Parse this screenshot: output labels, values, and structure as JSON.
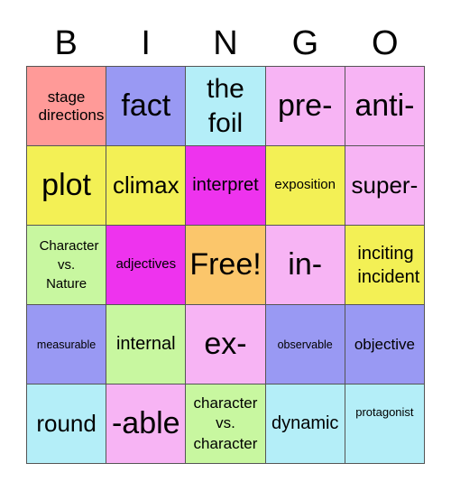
{
  "title_letters": [
    "B",
    "I",
    "N",
    "G",
    "O"
  ],
  "colors": {
    "salmon": "#FF9A98",
    "periwinkle": "#9999F3",
    "cyan": "#B4EEF8",
    "pink": "#F7B4F4",
    "yellow": "#F3F055",
    "magenta": "#EE33EE",
    "green": "#C8F7A0",
    "orange": "#FBC66B",
    "border": "#555555"
  },
  "board": {
    "rows": [
      [
        {
          "text": "stage directions",
          "color": "salmon"
        },
        {
          "text": "fact",
          "color": "periwinkle"
        },
        {
          "text": "the foil",
          "color": "cyan"
        },
        {
          "text": "pre-",
          "color": "pink"
        },
        {
          "text": "anti-",
          "color": "pink"
        }
      ],
      [
        {
          "text": "plot",
          "color": "yellow"
        },
        {
          "text": "climax",
          "color": "yellow"
        },
        {
          "text": "interpret",
          "color": "magenta"
        },
        {
          "text": "exposition",
          "color": "yellow"
        },
        {
          "text": "super-",
          "color": "pink"
        }
      ],
      [
        {
          "text": "Character vs. Nature",
          "color": "green"
        },
        {
          "text": "adjectives",
          "color": "magenta"
        },
        {
          "text": "Free!",
          "color": "orange"
        },
        {
          "text": "in-",
          "color": "pink"
        },
        {
          "text": "inciting incident",
          "color": "yellow"
        }
      ],
      [
        {
          "text": "measurable",
          "color": "periwinkle"
        },
        {
          "text": "internal",
          "color": "green"
        },
        {
          "text": "ex-",
          "color": "pink"
        },
        {
          "text": "observable",
          "color": "periwinkle"
        },
        {
          "text": "objective",
          "color": "periwinkle"
        }
      ],
      [
        {
          "text": "round",
          "color": "cyan"
        },
        {
          "text": "-able",
          "color": "pink"
        },
        {
          "text": "character vs. character",
          "color": "green"
        },
        {
          "text": "dynamic",
          "color": "cyan"
        },
        {
          "text": "protagonist",
          "color": "cyan"
        }
      ]
    ]
  }
}
